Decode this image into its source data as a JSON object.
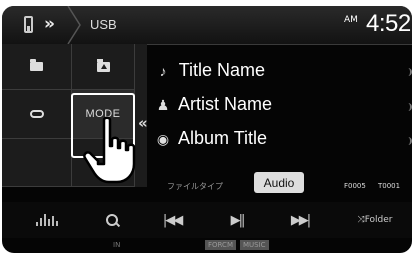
{
  "header": {
    "nav_chevron": "»",
    "source": "USB",
    "ampm": "AM",
    "clock": "4:52"
  },
  "panel": {
    "mode_label": "MODE",
    "collapse_symbol": "«"
  },
  "track": {
    "title": "Title Name",
    "artist": "Artist Name",
    "album": "Album Title"
  },
  "file_info": {
    "file_type_label": "ファイルタイプ",
    "format_button": "Audio",
    "folder_number": "F0005",
    "track_number": "T0001"
  },
  "controls": {
    "folder_label": "Folder"
  },
  "footer": {
    "in_label": "IN",
    "tag1": "FORCM",
    "tag2": "MUSIC"
  },
  "icons": {
    "usb": "usb-icon",
    "folder": "folder-icon",
    "folder_up": "folder-up-icon",
    "repeat": "repeat-icon",
    "note": "music-note-icon",
    "artist": "person-icon",
    "album": "disc-icon",
    "eq": "equalizer-icon",
    "search": "search-icon",
    "prev": "previous-icon",
    "play_pause": "play-pause-icon",
    "next": "next-icon",
    "shuffle": "shuffle-folder-icon",
    "hand": "pointing-hand-icon"
  },
  "colors": {
    "background": "#050505",
    "panel": "#1c1c1c",
    "text": "#ffffff",
    "button": "#dedede"
  }
}
